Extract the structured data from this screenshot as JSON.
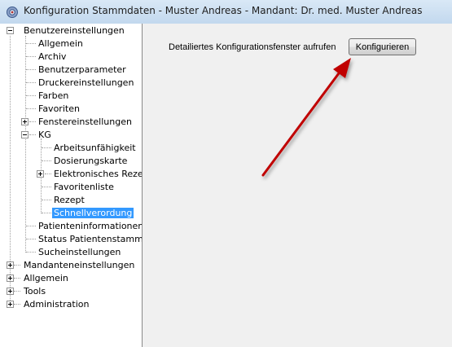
{
  "window": {
    "title": "Konfiguration Stammdaten - Muster Andreas - Mandant: Dr. med. Muster Andreas",
    "icon": "gear-icon"
  },
  "tree": {
    "benutzereinstellungen": "Benutzereinstellungen",
    "allgemein_sub": "Allgemein",
    "archiv": "Archiv",
    "benutzerparameter": "Benutzerparameter",
    "druckereinstellungen": "Druckereinstellungen",
    "farben": "Farben",
    "favoriten": "Favoriten",
    "fenstereinstellungen": "Fenstereinstellungen",
    "kg": "KG",
    "arbeitsunfaehigkeit": "Arbeitsunfähigkeit",
    "dosierungskarte": "Dosierungskarte",
    "elektronisches_rezept": "Elektronisches Reze",
    "favoritenliste": "Favoritenliste",
    "rezept": "Rezept",
    "schnellverordnung": "Schnellverordung",
    "patienteninformationen": "Patienteninformationen",
    "status_patientenstamm": "Status Patientenstammd",
    "sucheinstellungen": "Sucheinstellungen",
    "mandanteneinstellungen": "Mandanteneinstellungen",
    "allgemein_top": "Allgemein",
    "tools": "Tools",
    "administration": "Administration"
  },
  "main": {
    "description": "Detailiertes Konfigurationsfenster aufrufen",
    "configure_button": "Konfigurieren"
  },
  "colors": {
    "selection": "#3399ff",
    "arrow": "#c00000"
  }
}
